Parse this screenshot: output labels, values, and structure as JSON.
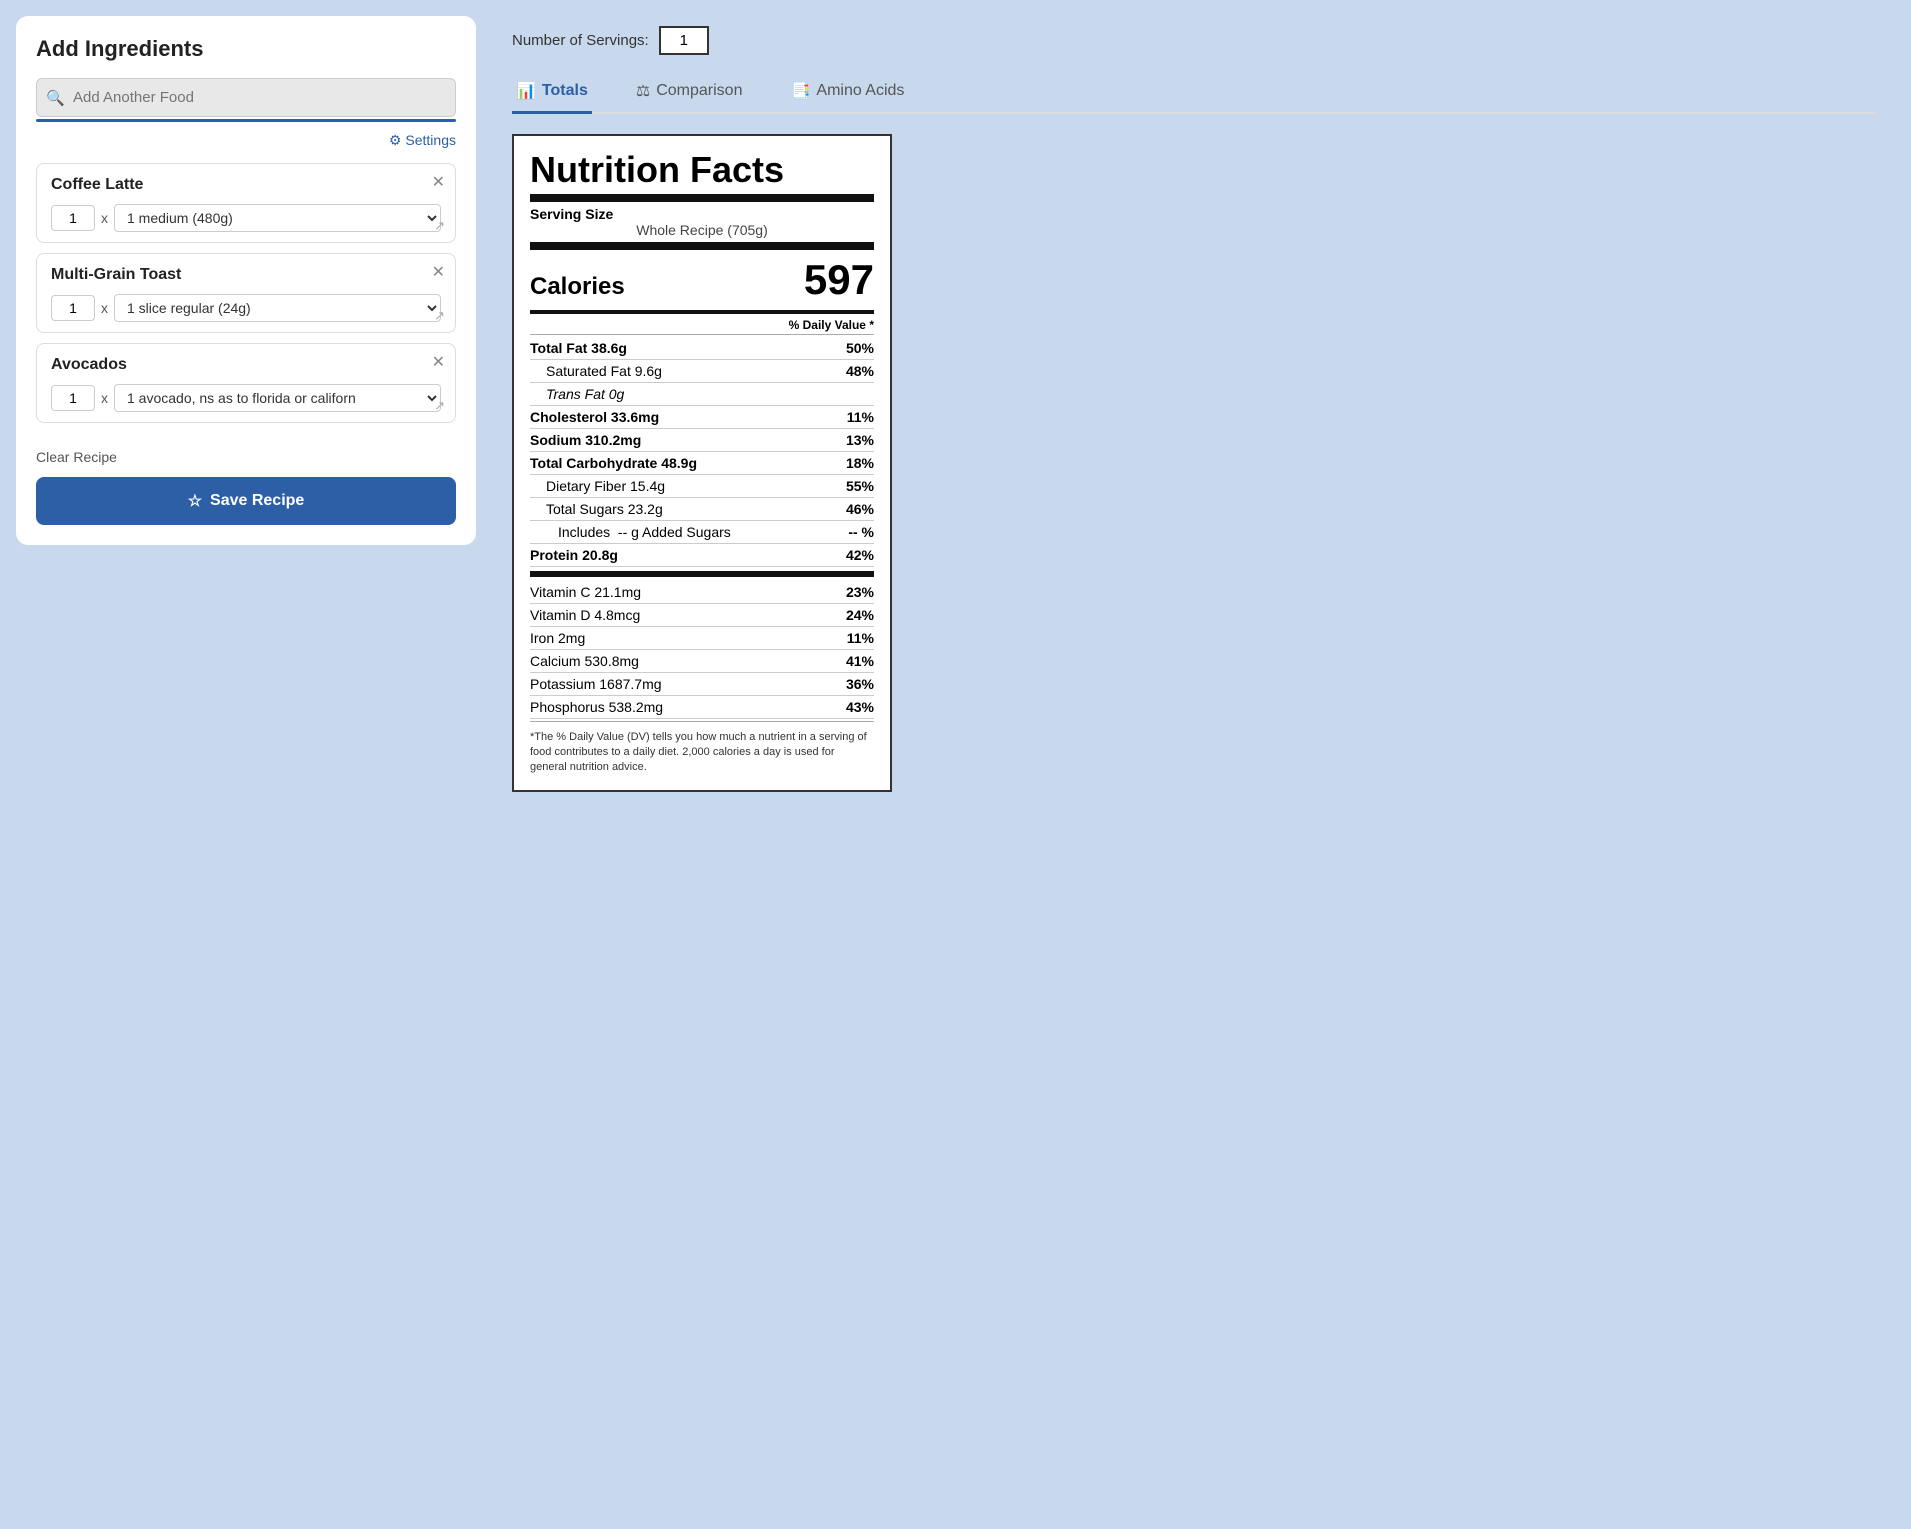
{
  "left": {
    "title": "Add Ingredients",
    "search_placeholder": "Add Another Food",
    "settings_label": "Settings",
    "ingredients": [
      {
        "name": "Coffee Latte",
        "qty": "1",
        "serving": "1 medium (480g)"
      },
      {
        "name": "Multi-Grain Toast",
        "qty": "1",
        "serving": "1 slice regular (24g)"
      },
      {
        "name": "Avocados",
        "qty": "1",
        "serving": "1 avocado, ns as to florida or californ"
      }
    ],
    "clear_label": "Clear Recipe",
    "save_label": "Save Recipe"
  },
  "right": {
    "servings_label": "Number of Servings:",
    "servings_value": "1",
    "tabs": [
      {
        "label": "Totals",
        "active": true
      },
      {
        "label": "Comparison",
        "active": false
      },
      {
        "label": "Amino Acids",
        "active": false
      }
    ]
  },
  "nutrition": {
    "title": "Nutrition Facts",
    "serving_size_label": "Serving Size",
    "serving_size_value": "Whole Recipe (705g)",
    "calories_label": "Calories",
    "calories_value": "597",
    "daily_value_header": "% Daily Value *",
    "rows": [
      {
        "label": "Total Fat 38.6g",
        "value": "50%",
        "bold": true,
        "indent": 0
      },
      {
        "label": "Saturated Fat 9.6g",
        "value": "48%",
        "bold": false,
        "indent": 1
      },
      {
        "label": "Trans Fat 0g",
        "value": "",
        "bold": false,
        "indent": 1,
        "italic": true
      },
      {
        "label": "Cholesterol 33.6mg",
        "value": "11%",
        "bold": true,
        "indent": 0
      },
      {
        "label": "Sodium 310.2mg",
        "value": "13%",
        "bold": true,
        "indent": 0
      },
      {
        "label": "Total Carbohydrate 48.9g",
        "value": "18%",
        "bold": true,
        "indent": 0
      },
      {
        "label": "Dietary Fiber 15.4g",
        "value": "55%",
        "bold": false,
        "indent": 1
      },
      {
        "label": "Total Sugars 23.2g",
        "value": "46%",
        "bold": false,
        "indent": 1
      },
      {
        "label": "Includes  --  g Added Sugars",
        "value": "-- %",
        "bold": false,
        "indent": 2
      },
      {
        "label": "Protein 20.8g",
        "value": "42%",
        "bold": true,
        "indent": 0
      }
    ],
    "vitamin_rows": [
      {
        "label": "Vitamin C 21.1mg",
        "value": "23%"
      },
      {
        "label": "Vitamin D 4.8mcg",
        "value": "24%"
      },
      {
        "label": "Iron 2mg",
        "value": "11%"
      },
      {
        "label": "Calcium 530.8mg",
        "value": "41%"
      },
      {
        "label": "Potassium 1687.7mg",
        "value": "36%"
      },
      {
        "label": "Phosphorus 538.2mg",
        "value": "43%"
      }
    ],
    "footer": "*The % Daily Value (DV) tells you how much a nutrient in a serving of food contributes to a daily diet. 2,000 calories a day is used for general nutrition advice."
  }
}
